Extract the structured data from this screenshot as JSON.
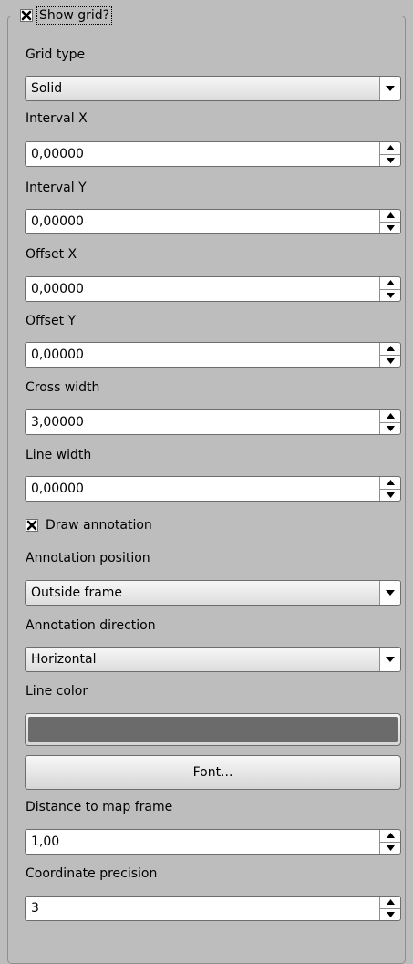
{
  "group": {
    "title": "Show grid?",
    "checked": true
  },
  "grid_type": {
    "label": "Grid type",
    "value": "Solid"
  },
  "interval_x": {
    "label": "Interval X",
    "value": "0,00000"
  },
  "interval_y": {
    "label": "Interval Y",
    "value": "0,00000"
  },
  "offset_x": {
    "label": "Offset X",
    "value": "0,00000"
  },
  "offset_y": {
    "label": "Offset Y",
    "value": "0,00000"
  },
  "cross_width": {
    "label": "Cross width",
    "value": "3,00000"
  },
  "line_width": {
    "label": "Line width",
    "value": "0,00000"
  },
  "draw_annotation": {
    "label": "Draw annotation",
    "checked": true
  },
  "annotation_position": {
    "label": "Annotation position",
    "value": "Outside frame"
  },
  "annotation_direction": {
    "label": "Annotation direction",
    "value": "Horizontal"
  },
  "line_color": {
    "label": "Line color",
    "color": "#6b6b6b"
  },
  "font_button": {
    "label": "Font..."
  },
  "distance_to_frame": {
    "label": "Distance to map frame",
    "value": "1,00"
  },
  "coordinate_precision": {
    "label": "Coordinate precision",
    "value": "3"
  },
  "icons": {
    "check": "check-x-icon",
    "dropdown": "chevron-down-icon",
    "spin_up": "spin-up-arrow-icon",
    "spin_down": "spin-down-arrow-icon"
  }
}
